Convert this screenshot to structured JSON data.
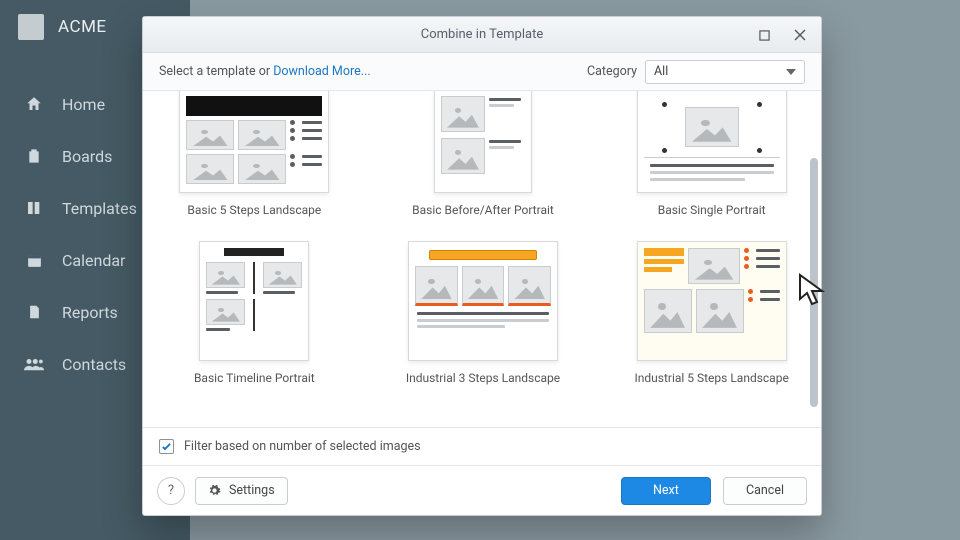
{
  "brand": {
    "name": "ACME"
  },
  "sidebar": {
    "items": [
      {
        "label": "Home",
        "icon": "home-icon"
      },
      {
        "label": "Boards",
        "icon": "clipboard-icon"
      },
      {
        "label": "Templates",
        "icon": "templates-icon"
      },
      {
        "label": "Calendar",
        "icon": "calendar-icon"
      },
      {
        "label": "Reports",
        "icon": "report-icon"
      },
      {
        "label": "Contacts",
        "icon": "contacts-icon"
      }
    ]
  },
  "modal": {
    "title": "Combine in Template",
    "prompt_prefix": "Select a template or ",
    "download_link": "Download More...",
    "category_label": "Category",
    "category_value": "All",
    "filter_checkbox_label": "Filter based on number of selected images",
    "filter_checked": true,
    "help_tooltip": "?",
    "settings_label": "Settings",
    "next_label": "Next",
    "cancel_label": "Cancel",
    "templates": [
      {
        "name": "Basic 5 Steps Landscape"
      },
      {
        "name": "Basic Before/After Portrait"
      },
      {
        "name": "Basic Single Portrait"
      },
      {
        "name": "Basic Timeline Portrait"
      },
      {
        "name": "Industrial 3 Steps Landscape"
      },
      {
        "name": "Industrial 5 Steps Landscape"
      }
    ],
    "scroll": {
      "top_pct": 20,
      "height_pct": 74
    }
  }
}
